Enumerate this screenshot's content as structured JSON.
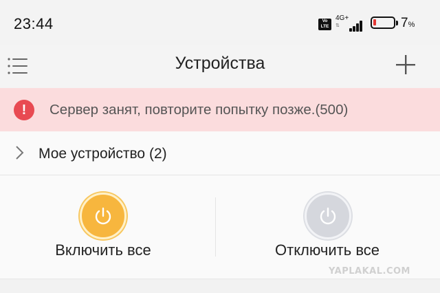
{
  "status_bar": {
    "time": "23:44",
    "volte_badge": "Vo LTE",
    "network_type": "4G+",
    "battery_percent": "7",
    "battery_unit": "%",
    "battery_level": 0.07,
    "battery_color": "#e53935"
  },
  "header": {
    "title": "Устройства",
    "menu_icon": "hamburger-menu-icon",
    "add_icon": "plus-icon"
  },
  "error_banner": {
    "icon": "exclamation-icon",
    "message": "Сервер занят, повторите попытку позже.(500)",
    "color": "#e84a52"
  },
  "device_group": {
    "label": "Мое устройство (2)",
    "icon": "chevron-right-icon"
  },
  "actions": {
    "turn_on_label": "Включить все",
    "turn_off_label": "Отключить все",
    "on_color": "#f7b63e",
    "off_color": "#d5d7dd",
    "icon": "power-icon"
  },
  "watermark": "YAPLAKAL.COM"
}
